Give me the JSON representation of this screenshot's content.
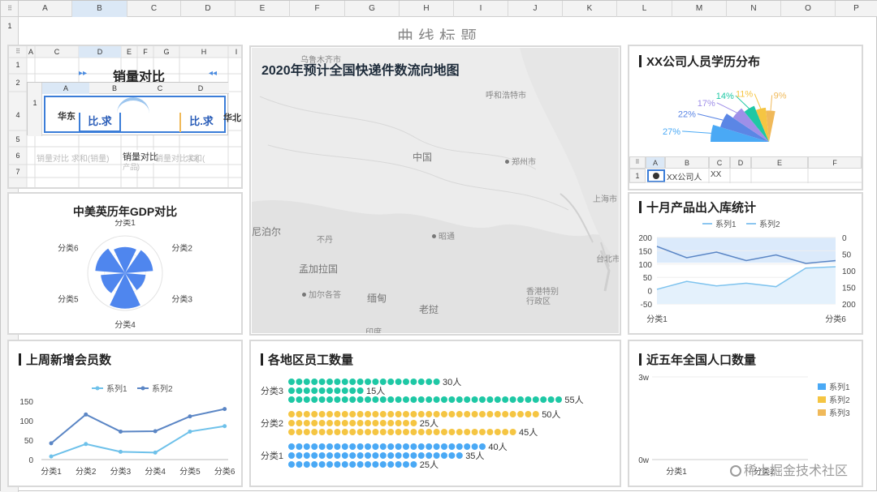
{
  "spreadsheet": {
    "columns": [
      "A",
      "B",
      "C",
      "D",
      "E",
      "F",
      "G",
      "H",
      "I",
      "J",
      "K",
      "L",
      "M",
      "N",
      "O",
      "P"
    ],
    "selected_column": "B",
    "rows": [
      "1"
    ],
    "title": "曲线标题"
  },
  "embedded_sheet1": {
    "columns": [
      "A",
      "C",
      "D",
      "E",
      "F",
      "G",
      "H",
      "I"
    ],
    "rows": [
      "1",
      "2",
      "4",
      "5",
      "6",
      "7"
    ],
    "title": "销量对比",
    "cells": [
      "比.求",
      "比.求",
      "华北",
      "销量对比",
      "销量对比 求和(销量)",
      "销量对比 G(",
      "求和(",
      "产品)"
    ],
    "sub_columns": [
      "A",
      "B",
      "C",
      "D"
    ],
    "sub_rows": [
      "1"
    ]
  },
  "map_panel": {
    "title": "2020年预计全国快递件数流向地图",
    "labels": [
      "乌鲁木齐市",
      "呼和浩特市",
      "中国",
      "郑州市",
      "上海市",
      "台北市",
      "尼泊尔",
      "不丹",
      "孟加拉国",
      "昭通",
      "加尔各答",
      "缅甸",
      "老挝",
      "香港特别行政区",
      "印度"
    ]
  },
  "edu_panel": {
    "title": "XX公司人员学历分布",
    "chart_data": {
      "type": "pie",
      "slices": [
        {
          "label": "27%",
          "value": 27,
          "color": "#4aa9f5"
        },
        {
          "label": "22%",
          "value": 22,
          "color": "#5b86e5"
        },
        {
          "label": "17%",
          "value": 17,
          "color": "#9f8fe8"
        },
        {
          "label": "14%",
          "value": 14,
          "color": "#1ec8a5"
        },
        {
          "label": "11%",
          "value": 11,
          "color": "#f5c542"
        },
        {
          "label": "9%",
          "value": 9,
          "color": "#f0b95a"
        }
      ]
    },
    "sheet_columns": [
      "A",
      "B",
      "C",
      "D",
      "E",
      "F"
    ],
    "sheet_rows": [
      "1"
    ],
    "sheet_cell": "XX公司人",
    "sheet_cell2": "XX"
  },
  "gdp_panel": {
    "title": "中美英历年GDP对比",
    "chart_data": {
      "type": "radar",
      "categories": [
        "分类1",
        "分类2",
        "分类3",
        "分类4",
        "分类5",
        "分类6"
      ],
      "values": [
        70,
        75,
        55,
        95,
        65,
        80
      ]
    }
  },
  "inout_panel": {
    "title": "十月产品出入库统计",
    "chart_data": {
      "type": "area",
      "x": [
        "分类1",
        "分类6"
      ],
      "series": [
        {
          "name": "系列1",
          "values": [
            5,
            35,
            18,
            28,
            15,
            85,
            90
          ]
        },
        {
          "name": "系列2",
          "values": [
            10,
            30,
            20,
            35,
            25,
            40,
            35
          ]
        }
      ],
      "ylim_left": [
        -50,
        200
      ],
      "ylim_right": [
        200,
        0
      ],
      "yticks_left": [
        "200",
        "150",
        "100",
        "50",
        "0",
        "-50"
      ],
      "yticks_right": [
        "0",
        "50",
        "100",
        "150",
        "200"
      ]
    }
  },
  "member_panel": {
    "title": "上周新增会员数",
    "chart_data": {
      "type": "line",
      "categories": [
        "分类1",
        "分类2",
        "分类3",
        "分类4",
        "分类5",
        "分类6"
      ],
      "series": [
        {
          "name": "系列1",
          "values": [
            8,
            40,
            20,
            18,
            72,
            86
          ]
        },
        {
          "name": "系列2",
          "values": [
            42,
            116,
            72,
            73,
            111,
            130
          ]
        }
      ],
      "ylim": [
        0,
        150
      ],
      "yticks": [
        "150",
        "100",
        "50",
        "0"
      ]
    }
  },
  "staff_panel": {
    "title": "各地区员工数量",
    "chart_data": {
      "type": "bar",
      "categories": [
        "分类3",
        "分类2",
        "分类1"
      ],
      "series": [
        {
          "name": "分类3",
          "bars": [
            {
              "value": 30,
              "label": "30人",
              "color": "#1ec8a5"
            },
            {
              "value": 15,
              "label": "15人",
              "color": "#1ec8a5"
            },
            {
              "value": 55,
              "label": "55人",
              "color": "#1ec8a5"
            }
          ]
        },
        {
          "name": "分类2",
          "bars": [
            {
              "value": 50,
              "label": "50人",
              "color": "#f5c542"
            },
            {
              "value": 25,
              "label": "25人",
              "color": "#f5c542"
            },
            {
              "value": 45,
              "label": "45人",
              "color": "#f5c542"
            }
          ]
        },
        {
          "name": "分类1",
          "bars": [
            {
              "value": 40,
              "label": "40人",
              "color": "#4aa9f5"
            },
            {
              "value": 35,
              "label": "35人",
              "color": "#4aa9f5"
            },
            {
              "value": 25,
              "label": "25人",
              "color": "#4aa9f5"
            }
          ]
        }
      ]
    }
  },
  "pop_panel": {
    "title": "近五年全国人口数量",
    "chart_data": {
      "type": "bar",
      "series": [
        {
          "name": "系列1",
          "color": "#4aa9f5"
        },
        {
          "name": "系列2",
          "color": "#f5c542"
        },
        {
          "name": "系列3",
          "color": "#f0b95a"
        }
      ],
      "yticks": [
        "3w",
        "0w"
      ],
      "categories": [
        "分类1",
        "分类2"
      ]
    }
  },
  "watermark": "稀土掘金技术社区"
}
